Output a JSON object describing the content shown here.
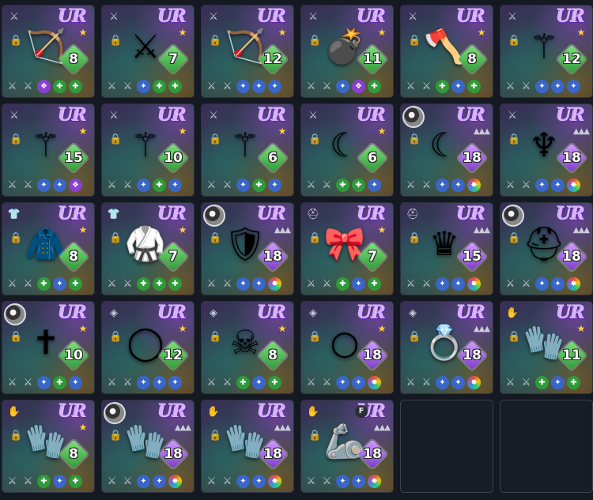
{
  "inventory": {
    "items": [
      {
        "slot": "weapon",
        "slot_icon": "sword-icon",
        "avatar": false,
        "rarity": "UR",
        "stars": "star",
        "art": "crossbow-icon",
        "level": "8",
        "level_color": "green",
        "stats": [
          "grey",
          "grey",
          "purple",
          "green",
          "green"
        ],
        "f_tag": ""
      },
      {
        "slot": "weapon",
        "slot_icon": "sword-icon",
        "avatar": false,
        "rarity": "UR",
        "stars": "star",
        "art": "claw-weapon-icon",
        "level": "7",
        "level_color": "green",
        "stats": [
          "grey",
          "grey",
          "blue",
          "green",
          "green"
        ],
        "f_tag": ""
      },
      {
        "slot": "weapon",
        "slot_icon": "sword-icon",
        "avatar": false,
        "rarity": "UR",
        "stars": "star",
        "art": "crossbow-icon",
        "level": "12",
        "level_color": "green",
        "stats": [
          "grey",
          "grey",
          "blue",
          "blue",
          "blue"
        ],
        "f_tag": ""
      },
      {
        "slot": "weapon",
        "slot_icon": "sword-icon",
        "avatar": false,
        "rarity": "UR",
        "stars": "star",
        "art": "bomb-icon",
        "level": "11",
        "level_color": "green",
        "stats": [
          "grey",
          "grey",
          "blue",
          "purple",
          "green"
        ],
        "f_tag": ""
      },
      {
        "slot": "weapon",
        "slot_icon": "sword-icon",
        "avatar": false,
        "rarity": "UR",
        "stars": "star",
        "art": "axe-icon",
        "level": "8",
        "level_color": "green",
        "stats": [
          "grey",
          "grey",
          "green",
          "blue",
          "green"
        ],
        "f_tag": ""
      },
      {
        "slot": "weapon",
        "slot_icon": "sword-icon",
        "avatar": false,
        "rarity": "UR",
        "stars": "star",
        "art": "staff-icon",
        "level": "12",
        "level_color": "green",
        "stats": [
          "grey",
          "grey",
          "blue",
          "blue",
          "blue"
        ],
        "f_tag": ""
      },
      {
        "slot": "weapon",
        "slot_icon": "sword-icon",
        "avatar": false,
        "rarity": "UR",
        "stars": "star",
        "art": "spear-icon",
        "level": "15",
        "level_color": "green",
        "stats": [
          "grey",
          "grey",
          "blue",
          "blue",
          "purple"
        ],
        "f_tag": ""
      },
      {
        "slot": "weapon",
        "slot_icon": "sword-icon",
        "avatar": false,
        "rarity": "UR",
        "stars": "star",
        "art": "spear-icon",
        "level": "10",
        "level_color": "green",
        "stats": [
          "grey",
          "grey",
          "blue",
          "green",
          "blue"
        ],
        "f_tag": ""
      },
      {
        "slot": "weapon",
        "slot_icon": "sword-icon",
        "avatar": false,
        "rarity": "UR",
        "stars": "star",
        "art": "spear-icon",
        "level": "6",
        "level_color": "green",
        "stats": [
          "grey",
          "grey",
          "blue",
          "green",
          "blue"
        ],
        "f_tag": ""
      },
      {
        "slot": "weapon",
        "slot_icon": "sword-icon",
        "avatar": false,
        "rarity": "UR",
        "stars": "star",
        "art": "scythe-icon",
        "level": "6",
        "level_color": "green",
        "stats": [
          "grey",
          "grey",
          "green",
          "green",
          "blue"
        ],
        "f_tag": ""
      },
      {
        "slot": "weapon",
        "slot_icon": "",
        "avatar": true,
        "rarity": "UR",
        "stars": "three",
        "art": "scythe-icon",
        "level": "18",
        "level_color": "purple",
        "stats": [
          "grey",
          "grey",
          "blue",
          "blue",
          "rainbow"
        ],
        "f_tag": ""
      },
      {
        "slot": "weapon",
        "slot_icon": "sword-icon",
        "avatar": false,
        "rarity": "UR",
        "stars": "three",
        "art": "trident-icon",
        "level": "18",
        "level_color": "purple",
        "stats": [
          "grey",
          "grey",
          "blue",
          "blue",
          "rainbow"
        ],
        "f_tag": ""
      },
      {
        "slot": "armor",
        "slot_icon": "armor-icon",
        "avatar": false,
        "rarity": "UR",
        "stars": "star",
        "art": "coat-icon",
        "level": "8",
        "level_color": "green",
        "stats": [
          "grey",
          "grey",
          "green",
          "blue",
          "green"
        ],
        "f_tag": ""
      },
      {
        "slot": "armor",
        "slot_icon": "armor-icon",
        "avatar": false,
        "rarity": "UR",
        "stars": "star",
        "art": "robe-icon",
        "level": "7",
        "level_color": "green",
        "stats": [
          "grey",
          "grey",
          "green",
          "green",
          "green"
        ],
        "f_tag": ""
      },
      {
        "slot": "armor",
        "slot_icon": "",
        "avatar": true,
        "rarity": "UR",
        "stars": "three",
        "art": "chest-armor-icon",
        "level": "18",
        "level_color": "purple",
        "stats": [
          "grey",
          "grey",
          "blue",
          "blue",
          "rainbow"
        ],
        "f_tag": ""
      },
      {
        "slot": "helmet",
        "slot_icon": "helmet-icon",
        "avatar": false,
        "rarity": "UR",
        "stars": "star",
        "art": "bow-ribbon-icon",
        "level": "7",
        "level_color": "green",
        "stats": [
          "grey",
          "grey",
          "green",
          "blue",
          "green"
        ],
        "f_tag": ""
      },
      {
        "slot": "helmet",
        "slot_icon": "helmet-icon",
        "avatar": false,
        "rarity": "UR",
        "stars": "three",
        "art": "crown-icon",
        "level": "15",
        "level_color": "purple",
        "stats": [
          "grey",
          "grey",
          "blue",
          "blue",
          "rainbow"
        ],
        "f_tag": ""
      },
      {
        "slot": "helmet",
        "slot_icon": "",
        "avatar": true,
        "rarity": "UR",
        "stars": "three",
        "art": "helmet-art-icon",
        "level": "18",
        "level_color": "purple",
        "stats": [
          "grey",
          "grey",
          "blue",
          "blue",
          "rainbow"
        ],
        "f_tag": ""
      },
      {
        "slot": "accessory",
        "slot_icon": "",
        "avatar": true,
        "rarity": "UR",
        "stars": "star",
        "art": "cross-necklace-icon",
        "level": "10",
        "level_color": "green",
        "stats": [
          "grey",
          "grey",
          "blue",
          "green",
          "blue"
        ],
        "f_tag": ""
      },
      {
        "slot": "accessory",
        "slot_icon": "gem-icon",
        "avatar": false,
        "rarity": "UR",
        "stars": "star",
        "art": "bracelet-icon",
        "level": "12",
        "level_color": "green",
        "stats": [
          "grey",
          "grey",
          "blue",
          "blue",
          "blue"
        ],
        "f_tag": ""
      },
      {
        "slot": "accessory",
        "slot_icon": "gem-icon",
        "avatar": false,
        "rarity": "UR",
        "stars": "star",
        "art": "skull-icon",
        "level": "8",
        "level_color": "green",
        "stats": [
          "grey",
          "grey",
          "green",
          "blue",
          "green"
        ],
        "f_tag": ""
      },
      {
        "slot": "accessory",
        "slot_icon": "gem-icon",
        "avatar": false,
        "rarity": "UR",
        "stars": "star",
        "art": "ring-icon",
        "level": "18",
        "level_color": "purple",
        "stats": [
          "grey",
          "grey",
          "blue",
          "blue",
          "rainbow"
        ],
        "f_tag": ""
      },
      {
        "slot": "accessory",
        "slot_icon": "gem-icon",
        "avatar": false,
        "rarity": "UR",
        "stars": "three",
        "art": "gem-ring-icon",
        "level": "18",
        "level_color": "purple",
        "stats": [
          "grey",
          "grey",
          "blue",
          "blue",
          "rainbow"
        ],
        "f_tag": ""
      },
      {
        "slot": "gloves",
        "slot_icon": "glove-icon",
        "avatar": false,
        "rarity": "UR",
        "stars": "star",
        "art": "glove-art-icon",
        "level": "11",
        "level_color": "green",
        "stats": [
          "grey",
          "grey",
          "green",
          "blue",
          "green"
        ],
        "f_tag": ""
      },
      {
        "slot": "gloves",
        "slot_icon": "glove-icon",
        "avatar": false,
        "rarity": "UR",
        "stars": "star",
        "art": "glove-art-icon",
        "level": "8",
        "level_color": "green",
        "stats": [
          "grey",
          "grey",
          "green",
          "blue",
          "green"
        ],
        "f_tag": ""
      },
      {
        "slot": "gloves",
        "slot_icon": "",
        "avatar": true,
        "rarity": "UR",
        "stars": "three",
        "art": "gauntlet-icon",
        "level": "18",
        "level_color": "purple",
        "stats": [
          "grey",
          "grey",
          "blue",
          "blue",
          "rainbow"
        ],
        "f_tag": ""
      },
      {
        "slot": "gloves",
        "slot_icon": "glove-icon",
        "avatar": false,
        "rarity": "UR",
        "stars": "three",
        "art": "gauntlet-icon",
        "level": "18",
        "level_color": "purple",
        "stats": [
          "grey",
          "grey",
          "blue",
          "blue",
          "rainbow"
        ],
        "f_tag": ""
      },
      {
        "slot": "gloves",
        "slot_icon": "glove-icon",
        "avatar": false,
        "rarity": "UR",
        "stars": "three",
        "art": "armored-arm-icon",
        "level": "18",
        "level_color": "purple",
        "stats": [
          "grey",
          "grey",
          "blue",
          "blue",
          "rainbow"
        ],
        "f_tag": "F"
      },
      {
        "empty": true
      },
      {
        "empty": true
      }
    ]
  },
  "colors": {
    "background": "#141922",
    "rarity": "#d9b3ff",
    "star": "#ffcf3a",
    "level_green": "#2f9a3a",
    "level_purple": "#7a3bc9"
  }
}
